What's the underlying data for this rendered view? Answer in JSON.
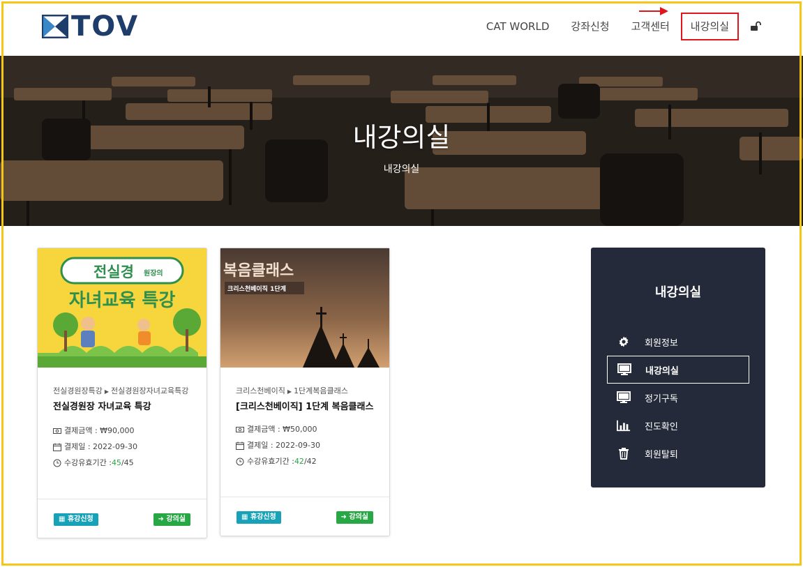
{
  "header": {
    "logo_text": "TOV",
    "nav": [
      {
        "label": "CAT WORLD"
      },
      {
        "label": "강좌신청"
      },
      {
        "label": "고객센터"
      },
      {
        "label": "내강의실"
      }
    ]
  },
  "hero": {
    "title": "내강의실",
    "subtitle": "내강의실"
  },
  "courses": [
    {
      "thumb_top": "전실경",
      "thumb_top_small": "원장의",
      "thumb_main": "자녀교육 특강",
      "category": "전실경원장특강",
      "subcategory": "전실경원장자녀교육특강",
      "title": "전실경원장 자녀교육 특강",
      "price_label": "결제금액 : ₩90,000",
      "date_label": "결제일 : 2022-09-30",
      "period_label": "수강유효기간 : ",
      "period_remaining": "45",
      "period_total": "/45",
      "rest_button": "휴강신청",
      "class_button": "강의실"
    },
    {
      "thumb_top": "복음클래스",
      "thumb_main": "크리스천베이직 1단계",
      "category": "크리스천베이직",
      "subcategory": "1단계복음클래스",
      "title": "[크리스천베이직] 1단계 복음클래스",
      "price_label": "결제금액 : ₩50,000",
      "date_label": "결제일 : 2022-09-30",
      "period_label": "수강유효기간 : ",
      "period_remaining": "42",
      "period_total": "/42",
      "rest_button": "휴강신청",
      "class_button": "강의실"
    }
  ],
  "sidebar": {
    "title": "내강의실",
    "items": [
      {
        "label": "회원정보",
        "icon": "gear-icon"
      },
      {
        "label": "내강의실",
        "icon": "monitor-icon"
      },
      {
        "label": "정기구독",
        "icon": "monitor-icon"
      },
      {
        "label": "진도확인",
        "icon": "bar-chart-icon"
      },
      {
        "label": "회원탈퇴",
        "icon": "trash-icon"
      }
    ]
  },
  "colors": {
    "brand": "#1e3d6b",
    "highlight_red": "#e0151b",
    "frame_yellow": "#f5c518",
    "sidebar_bg": "#252a3a",
    "btn_teal": "#17a2b8",
    "btn_green": "#28a745"
  }
}
